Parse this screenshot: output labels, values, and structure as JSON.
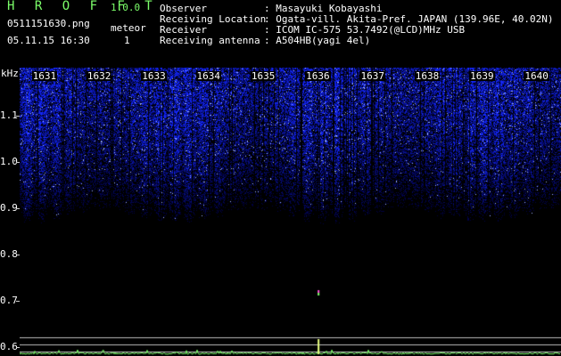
{
  "app": {
    "title": "H R O F F T",
    "version": "1.0.0"
  },
  "file": {
    "name": "0511151630.png",
    "datetime": "05.11.15 16:30"
  },
  "meteor": {
    "label": "meteor",
    "count": "1"
  },
  "info": [
    {
      "key": "Observer",
      "value": ": Masayuki Kobayashi"
    },
    {
      "key": "Receiving Location",
      "value": ": Ogata-vill. Akita-Pref. JAPAN (139.96E, 40.02N)"
    },
    {
      "key": "Receiver",
      "value": ": ICOM IC-575 53.7492(@LCD)MHz USB"
    },
    {
      "key": "Receiving antenna",
      "value": ": A504HB(yagi 4el)"
    }
  ],
  "colors": {
    "label_green": "#7cff6a",
    "noise_blue": "#1a2ad0",
    "trace_green": "#7cff6a",
    "ref_line": "#bbbbbb"
  },
  "chart_data": {
    "type": "heatmap",
    "ylabel": "kHz",
    "yticks": [
      "1.1",
      "1.0",
      "0.9",
      "0.8",
      "0.7",
      "0.6"
    ],
    "ytick_values": [
      1.1,
      1.0,
      0.9,
      0.8,
      0.7,
      0.6
    ],
    "xticks": [
      "1631",
      "1632",
      "1633",
      "1634",
      "1635",
      "1636",
      "1637",
      "1638",
      "1639",
      "1640"
    ],
    "xtick_values": [
      1631,
      1632,
      1633,
      1634,
      1635,
      1636,
      1637,
      1638,
      1639,
      1640
    ],
    "x_range": [
      1630.55,
      1640.45
    ],
    "y_range": [
      0.58,
      1.205
    ],
    "meteor_events": [
      {
        "time": 1636.0,
        "freq": 0.715
      }
    ],
    "spectrum_reference_levels_khz": [
      0.62,
      0.605,
      0.59
    ]
  }
}
